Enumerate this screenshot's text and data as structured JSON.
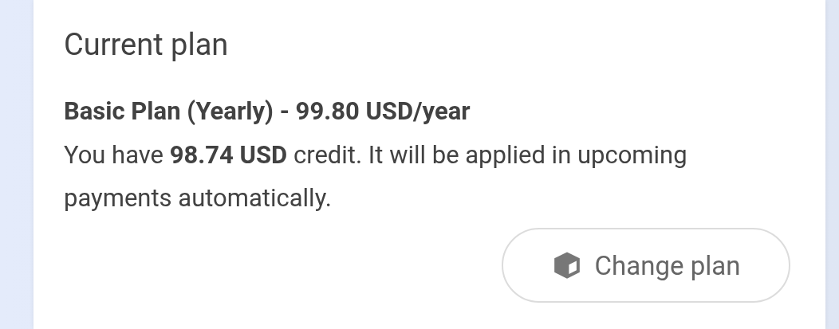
{
  "card": {
    "title": "Current plan",
    "plan": "Basic Plan (Yearly) - 99.80 USD/year",
    "credit_note": "You have **98.74 USD** credit. It will be applied in upcoming payments automatically.",
    "button": {
      "label": "Change plan"
    }
  }
}
